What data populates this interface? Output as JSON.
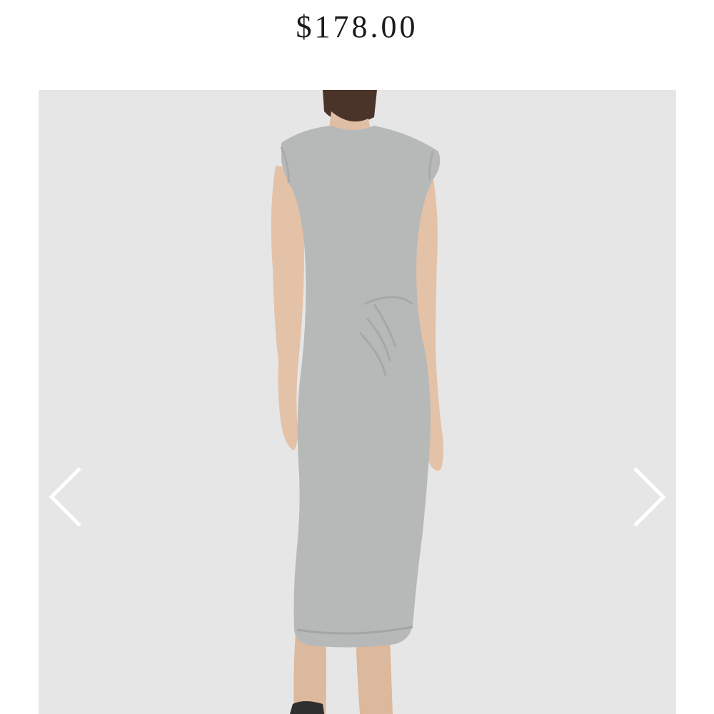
{
  "product": {
    "price": "$178.00",
    "image_description_icon": "product-photo-grey-dress"
  },
  "gallery": {
    "prev_icon": "chevron-left-icon",
    "next_icon": "chevron-right-icon"
  },
  "colors": {
    "background": "#ffffff",
    "gallery_bg": "#e6e6e6",
    "dress": "#b7b9b9",
    "skin": "#e3c2a8",
    "hair": "#4a3328",
    "arrow": "#ffffff"
  }
}
